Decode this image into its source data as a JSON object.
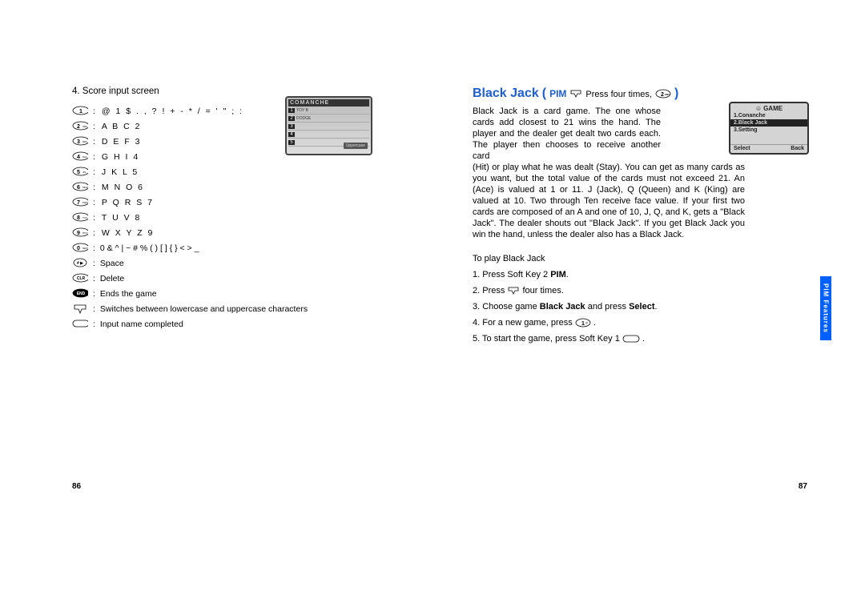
{
  "left": {
    "section_heading": "4. Score input screen",
    "keys": [
      {
        "icon": "1",
        "shape": "oval",
        "text": "@ 1 $ . , ? ! + - * / = ' \" ; :"
      },
      {
        "icon": "2",
        "sub": "ABC",
        "shape": "oval",
        "text": "A B C 2"
      },
      {
        "icon": "3",
        "sub": "DEF",
        "shape": "oval",
        "text": "D E F 3"
      },
      {
        "icon": "4",
        "sub": "GHI",
        "shape": "oval",
        "text": "G H I 4"
      },
      {
        "icon": "5",
        "sub": "JKL",
        "shape": "oval",
        "text": "J K L 5"
      },
      {
        "icon": "6",
        "sub": "MNO",
        "shape": "oval",
        "text": "M N O 6"
      },
      {
        "icon": "7",
        "sub": "PQRS",
        "shape": "oval",
        "text": "P Q R S 7"
      },
      {
        "icon": "8",
        "sub": "TUV",
        "shape": "oval",
        "text": "T U V 8"
      },
      {
        "icon": "9",
        "sub": "WXYZ",
        "shape": "oval",
        "text": "W X Y Z 9"
      },
      {
        "icon": "0",
        "sub": "NEXT",
        "shape": "oval",
        "text": "0 & ^ | ~ # % ( ) [ ] { } < > _"
      },
      {
        "icon": "# ▶",
        "shape": "oval-small",
        "text": "Space"
      },
      {
        "icon": "CLR",
        "shape": "oval-wide",
        "text": "Delete"
      },
      {
        "icon": "END",
        "shape": "oval-wide-dark",
        "text": "Ends the game"
      },
      {
        "icon": "nav",
        "shape": "nav",
        "text": "Switches between lowercase and uppercase characters"
      },
      {
        "icon": "ok",
        "shape": "pill",
        "text": "Input name completed"
      }
    ],
    "screenshot": {
      "title": "COMANCHE",
      "rows": [
        "1",
        "2",
        "3",
        "4",
        "5"
      ],
      "badge": "Uppercase"
    },
    "page_num": "86"
  },
  "right": {
    "title_main": "Black Jack",
    "title_bracket_open": "(",
    "title_pim": "PIM",
    "title_nav_text": "Press four times,",
    "title_key": "2",
    "title_bracket_close": ")",
    "body_narrow": "Black Jack is a card game. The one whose cards add closest to 21 wins the hand. The player and the dealer get dealt two cards each. The player then chooses to receive another card",
    "body_full": "(Hit) or play what he was dealt (Stay). You can get as many cards as you want, but the total value of the cards must not exceed 21. An (Ace) is valued at 1 or 11. J (Jack), Q (Queen) and K (King) are valued at 10. Two through Ten receive face value. If your first two cards are composed of an A and one of 10, J, Q, and K, gets a \"Black Jack\". The dealer shouts out \"Black Jack\". If you get Black Jack you win the hand, unless the dealer also has a Black Jack.",
    "instr_header": "To play Black Jack",
    "steps": [
      {
        "n": "1.",
        "text_before": "Press Soft Key 2 ",
        "bold": "PIM",
        "text_after": "."
      },
      {
        "n": "2.",
        "text_before": "Press ",
        "icon": "nav",
        "text_after": " four times."
      },
      {
        "n": "3.",
        "text_before": "Choose game ",
        "bold": "Black Jack",
        "text_mid": " and press ",
        "bold2": "Select",
        "text_after": "."
      },
      {
        "n": "4.",
        "text_before": "For a new game, press ",
        "icon": "key1",
        "text_after": " ."
      },
      {
        "n": "5.",
        "text_before": "To start the game, press Soft Key 1 ",
        "icon": "pill",
        "text_after": " ."
      }
    ],
    "screenshot": {
      "header_icon": "☺",
      "header_text": "GAME",
      "items": [
        "1.Conanche",
        "2.Black Jack",
        "3.Setting"
      ],
      "selected_index": 1,
      "footer_left": "Select",
      "footer_right": "Back"
    },
    "side_tab": "PIM Features",
    "page_num": "87"
  }
}
